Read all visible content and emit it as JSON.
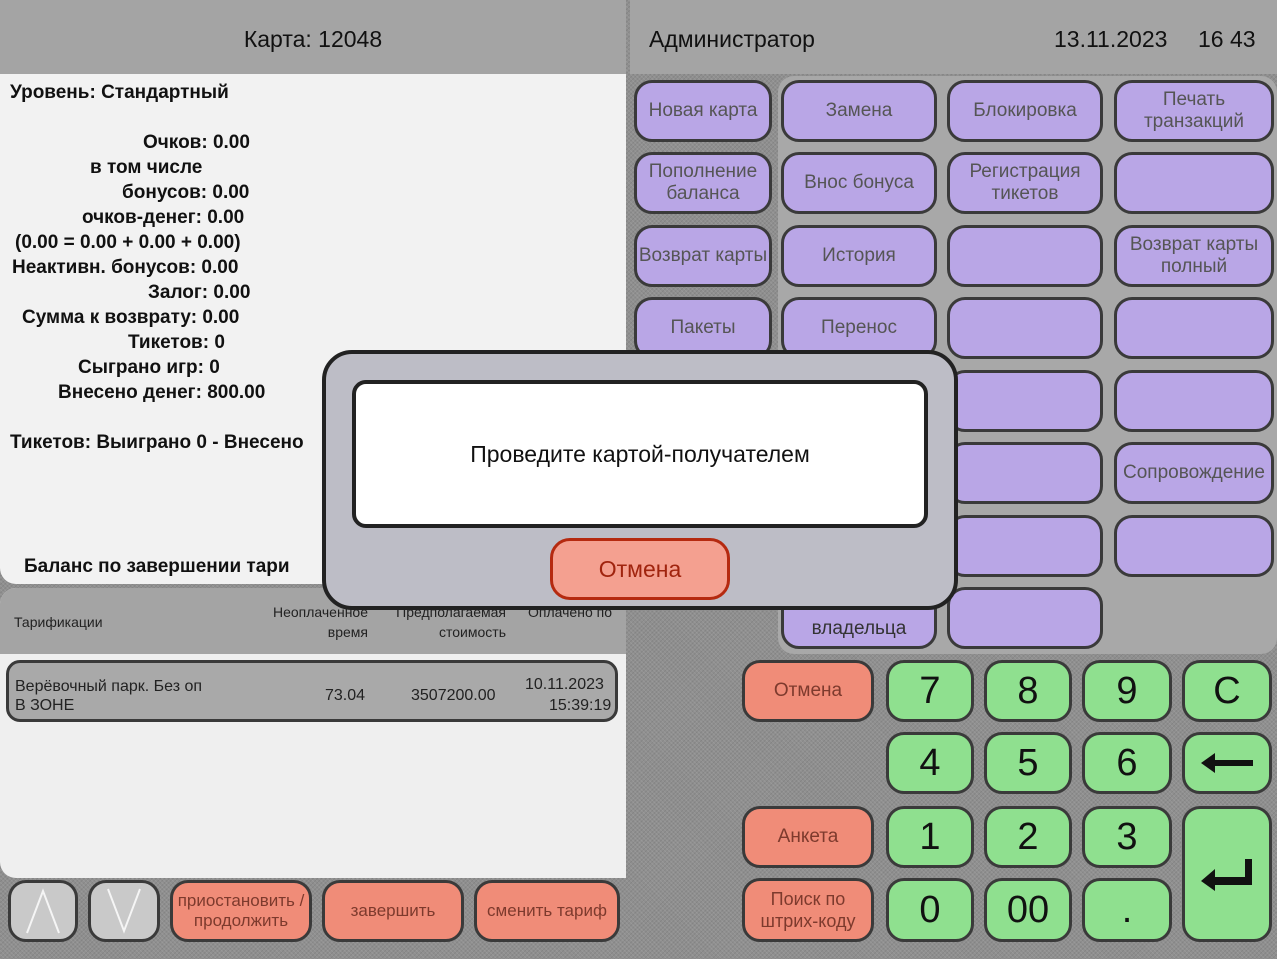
{
  "header": {
    "card_label": "Карта: 12048",
    "user": "Администратор",
    "date": "13.11.2023",
    "time": "16 43"
  },
  "card_info": {
    "level": "Уровень: Стандартный",
    "points": "Очков: 0.00",
    "including": "в том числе",
    "bonuses": "бонусов: 0.00",
    "money_points": "очков-денег: 0.00",
    "formula": "(0.00 = 0.00 + 0.00 + 0.00)",
    "inactive_bonuses": "Неактивн. бонусов: 0.00",
    "deposit": "Залог: 0.00",
    "refund_sum": "Сумма к возврату: 0.00",
    "tickets": "Тикетов: 0",
    "games_played": "Сыграно игр: 0",
    "money_in": "Внесено денег: 800.00",
    "tickets_summary": "Тикетов: Выиграно 0 - Внесено",
    "balance_after": "Баланс по завершении тари"
  },
  "tariffs": {
    "columns": [
      "Тарификации",
      "Неоплаченное время",
      "Предполагаемая стоимость",
      "Оплачено по"
    ],
    "rows": [
      {
        "name": "Верёвочный парк. Без оп",
        "zone": "В ЗОНЕ",
        "time": "73.04",
        "cost": "3507200.00",
        "date": "10.11.2023",
        "clock": "15:39:19"
      }
    ]
  },
  "actions": [
    {
      "id": "new-card",
      "label": "Новая карта",
      "dim": false
    },
    {
      "id": "replace",
      "label": "Замена",
      "dim": false
    },
    {
      "id": "block",
      "label": "Блокировка",
      "dim": false
    },
    {
      "id": "print-transactions",
      "label": "Печать транзакций",
      "dim": false
    },
    {
      "id": "topup",
      "label": "Пополнение баланса",
      "dim": false
    },
    {
      "id": "bonus-in",
      "label": "Внос бонуса",
      "dim": false
    },
    {
      "id": "register-tickets",
      "label": "Регистрация тикетов",
      "dim": false
    },
    {
      "id": "r2c4",
      "label": "",
      "dim": true
    },
    {
      "id": "return-card",
      "label": "Возврат карты",
      "dim": false
    },
    {
      "id": "history",
      "label": "История",
      "dim": false
    },
    {
      "id": "r3c3",
      "label": "",
      "dim": true
    },
    {
      "id": "return-card-full",
      "label": "Возврат карты полный",
      "dim": false
    },
    {
      "id": "packages",
      "label": "Пакеты",
      "dim": false
    },
    {
      "id": "transfer",
      "label": "Перенос",
      "dim": false
    },
    {
      "id": "r4c3",
      "label": "",
      "dim": true
    },
    {
      "id": "r4c4",
      "label": "",
      "dim": true
    },
    {
      "id": "r5c3",
      "label": "",
      "dim": true
    },
    {
      "id": "r5c4",
      "label": "",
      "dim": true
    },
    {
      "id": "r6c3",
      "label": "",
      "dim": true
    },
    {
      "id": "escort",
      "label": "Сопровождение",
      "dim": false
    },
    {
      "id": "r7c3",
      "label": "",
      "dim": true
    },
    {
      "id": "r7c4",
      "label": "",
      "dim": true
    },
    {
      "id": "owner",
      "label": "владельца",
      "dim": false
    },
    {
      "id": "r8c3",
      "label": "",
      "dim": true
    }
  ],
  "keypad": {
    "cancel": "Отмена",
    "survey": "Анкета",
    "barcode": "Поиск по штрих-коду",
    "keys": [
      "7",
      "8",
      "9",
      "C",
      "4",
      "5",
      "6",
      "1",
      "2",
      "3",
      "0",
      "00",
      "."
    ]
  },
  "bottom": {
    "pause": "приостановить / продолжить",
    "finish": "завершить",
    "change": "сменить тариф"
  },
  "modal": {
    "message": "Проведите картой-получателем",
    "cancel": "Отмена"
  }
}
